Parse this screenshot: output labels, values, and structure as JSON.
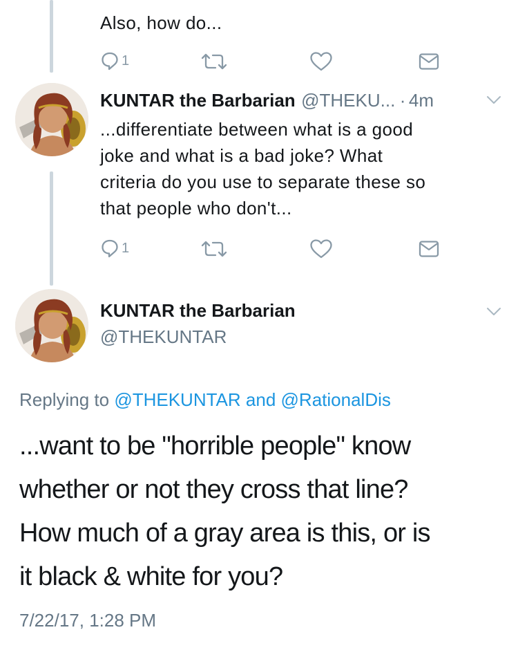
{
  "tweet_prev": {
    "text": "Also, how do...",
    "reply_count": "1"
  },
  "tweet_mid": {
    "author_name": "KUNTAR the Barbarian",
    "author_handle": "@THEKU...",
    "separator": "·",
    "time": "4m",
    "text_lines": [
      "...differentiate between what is a good",
      "joke and what is a bad joke? What",
      "criteria do you use to separate these so",
      "that people who don't..."
    ],
    "reply_count": "1"
  },
  "tweet_main": {
    "author_name": "KUNTAR the Barbarian",
    "author_handle": "@THEKUNTAR",
    "replying_prefix": "Replying to",
    "replying_user1": "@THEKUNTAR",
    "replying_and": "and",
    "replying_user2": "@RationalDis",
    "text_lines": [
      "...want to be \"horrible people\" know",
      "whether or not they cross that line?",
      "How much of a gray area is this, or is",
      "it black & white for you?"
    ],
    "timestamp": "7/22/17, 1:28 PM"
  },
  "icons": {
    "reply": "reply-icon",
    "retweet": "retweet-icon",
    "like": "heart-icon",
    "dm": "envelope-icon",
    "menu": "chevron-down-icon"
  },
  "colors": {
    "text": "#14171a",
    "muted": "#657786",
    "icon": "#8899a6",
    "link": "#1b95e0",
    "thread_line": "#ccd6dd"
  }
}
